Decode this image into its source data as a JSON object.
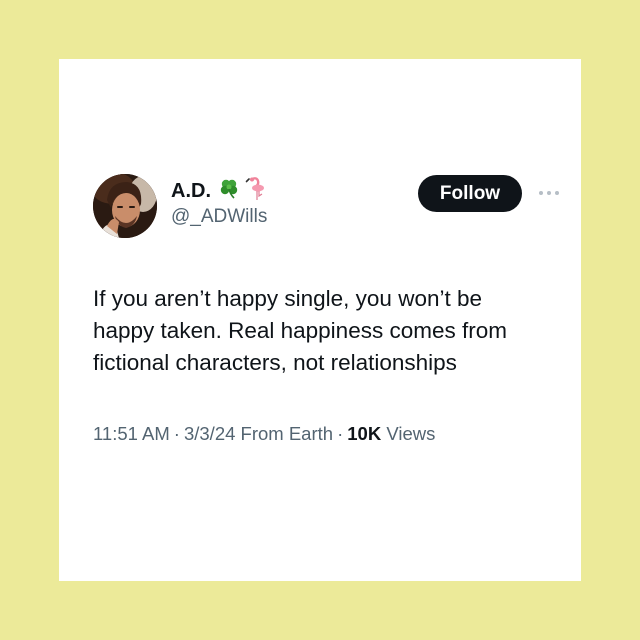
{
  "background_color": "#ecea99",
  "card_color": "#ffffff",
  "user": {
    "display_name": "A.D.",
    "emojis": [
      "clover-icon",
      "flamingo-icon"
    ],
    "handle": "@_ADWills",
    "avatar": "profile-photo"
  },
  "follow_button": {
    "label": "Follow",
    "color": "#0f1419"
  },
  "more_icon": "more-dots-icon",
  "tweet": {
    "lines": [
      "If you aren’t happy single, you won’t be",
      "happy taken. Real happiness comes from",
      "fictional characters, not relationships"
    ]
  },
  "meta": {
    "time": "11:51 AM",
    "date": "3/3/24",
    "source": "From Earth",
    "views_count": "10K",
    "views_label": "Views",
    "separator": "·"
  }
}
